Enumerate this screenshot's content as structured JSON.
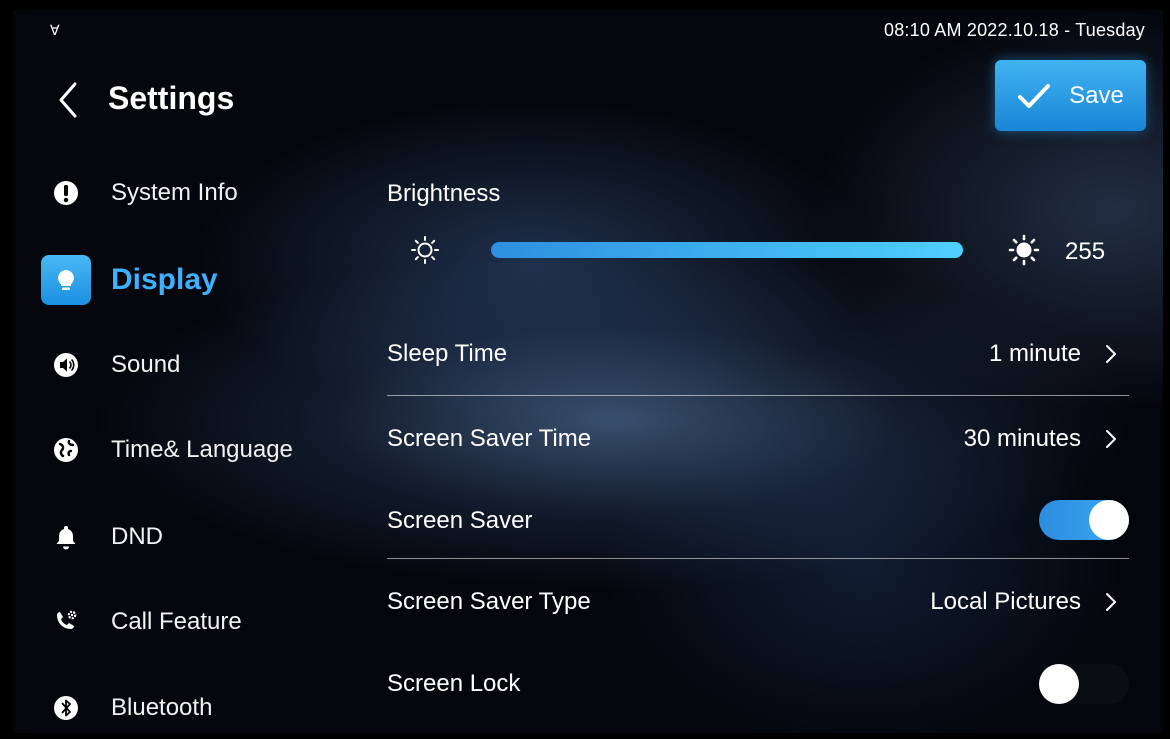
{
  "status_bar": {
    "clock": "08:10 AM  2022.10.18 - Tuesday"
  },
  "header": {
    "title": "Settings",
    "save_label": "Save"
  },
  "sidebar": {
    "items": [
      {
        "label": "System Info",
        "icon": "info-icon"
      },
      {
        "label": "Display",
        "icon": "bulb-icon",
        "active": true
      },
      {
        "label": "Sound",
        "icon": "speaker-icon"
      },
      {
        "label": "Time& Language",
        "icon": "globe-icon"
      },
      {
        "label": "DND",
        "icon": "bell-icon"
      },
      {
        "label": "Call Feature",
        "icon": "phone-gear-icon"
      },
      {
        "label": "Bluetooth",
        "icon": "bluetooth-icon"
      }
    ]
  },
  "display": {
    "brightness": {
      "label": "Brightness",
      "value": "255",
      "level": 1.0
    },
    "sleep_time": {
      "label": "Sleep Time",
      "value": "1 minute"
    },
    "screen_saver_time": {
      "label": "Screen Saver Time",
      "value": "30 minutes"
    },
    "screen_saver": {
      "label": "Screen Saver",
      "enabled": true
    },
    "screen_saver_type": {
      "label": "Screen Saver Type",
      "value": "Local Pictures"
    },
    "screen_lock": {
      "label": "Screen Lock",
      "enabled": false
    }
  },
  "colors": {
    "accent": "#3db1ff",
    "active_icon_bg": "#2c9ee8",
    "background": "#04060c"
  }
}
